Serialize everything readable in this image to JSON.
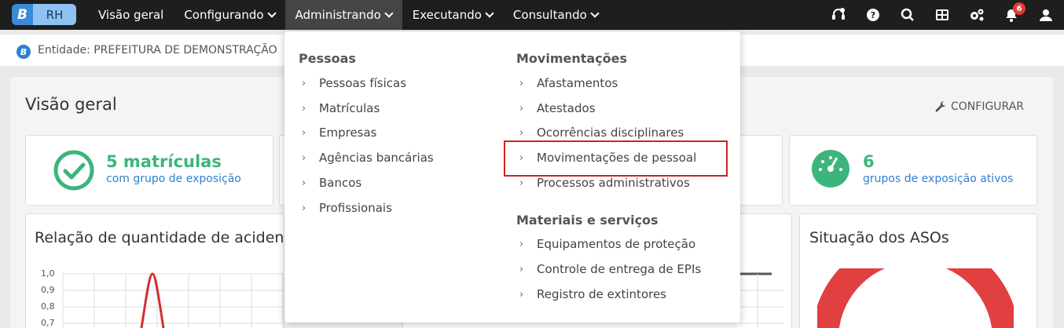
{
  "app": {
    "logo_letter": "B",
    "logo_label": "RH"
  },
  "nav": {
    "items": [
      {
        "label": "Visão geral",
        "has_menu": false,
        "active": false
      },
      {
        "label": "Configurando",
        "has_menu": true,
        "active": false
      },
      {
        "label": "Administrando",
        "has_menu": true,
        "active": true
      },
      {
        "label": "Executando",
        "has_menu": true,
        "active": false
      },
      {
        "label": "Consultando",
        "has_menu": true,
        "active": false
      }
    ]
  },
  "toolbar": {
    "icons": [
      "support-icon",
      "help-icon",
      "search-icon",
      "apps-grid-icon",
      "settings-icon",
      "notifications-icon",
      "user-icon"
    ],
    "notification_count": "6"
  },
  "entity": {
    "icon_letter": "B",
    "label": "Entidade: PREFEITURA DE DEMONSTRAÇÃO"
  },
  "page": {
    "title": "Visão geral",
    "configure_label": "CONFIGURAR"
  },
  "stats": [
    {
      "value": "5 matrículas",
      "label": "com grupo de exposição",
      "icon": "check-circle-icon",
      "color": "#3cb57a"
    },
    {
      "value": "6",
      "label": "grupos de exposição ativos",
      "icon": "gauge-icon",
      "color": "#3cb57a"
    }
  ],
  "charts": {
    "accidents_title": "Relação de quantidade de acidente",
    "aso_title": "Situação dos ASOs",
    "y_ticks": [
      "1,0",
      "0,9",
      "0,8",
      "0,7"
    ]
  },
  "chart_data": {
    "type": "line",
    "ylim": [
      0.7,
      1.0
    ],
    "yticks": [
      1.0,
      0.9,
      0.8,
      0.7
    ]
  },
  "menu": {
    "col1": {
      "heading": "Pessoas",
      "items": [
        "Pessoas físicas",
        "Matrículas",
        "Empresas",
        "Agências bancárias",
        "Bancos",
        "Profissionais"
      ]
    },
    "col2": {
      "heading": "Movimentações",
      "items": [
        "Afastamentos",
        "Atestados",
        "Ocorrências disciplinares",
        "Movimentações de pessoal",
        "Processos administrativos"
      ]
    },
    "col3": {
      "heading": "Materiais e serviços",
      "items": [
        "Equipamentos de proteção",
        "Controle de entrega de EPIs",
        "Registro de extintores"
      ]
    }
  },
  "colors": {
    "topbar": "#1e1e1e",
    "accent_blue": "#2f7fd0",
    "accent_green": "#3cb57a",
    "highlight": "#d32020",
    "aso_red": "#e04040"
  }
}
